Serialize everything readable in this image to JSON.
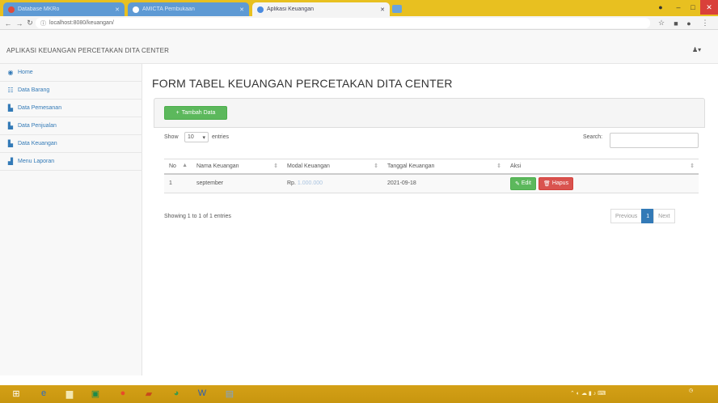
{
  "browser": {
    "tabs": [
      {
        "title": "Database MKRo",
        "active": false,
        "favicon": "db-icon"
      },
      {
        "title": "AMICTA Pembukaan",
        "active": false,
        "favicon": "chrome-icon"
      },
      {
        "title": "Aplikasi Keuangan",
        "active": true,
        "favicon": "chrome-icon"
      }
    ],
    "url": "localhost:8080/keuangan/"
  },
  "app": {
    "brand": "APLIKASI KEUANGAN PERCETAKAN DITA CENTER",
    "user_icon": "user-icon"
  },
  "sidebar": {
    "items": [
      {
        "label": "Home",
        "icon": "dashboard-icon"
      },
      {
        "label": "Data Barang",
        "icon": "table-icon"
      },
      {
        "label": "Data Pemesanan",
        "icon": "edit-icon"
      },
      {
        "label": "Data Penjualan",
        "icon": "edit-icon"
      },
      {
        "label": "Data Keuangan",
        "icon": "edit-icon"
      },
      {
        "label": "Menu Laporan",
        "icon": "chart-icon"
      }
    ]
  },
  "main": {
    "title": "FORM TABEL KEUANGAN PERCETAKAN DITA CENTER",
    "add_button": "Tambah Data",
    "show_label": "Show",
    "show_value": "10",
    "entries_label": "entries",
    "search_label": "Search:",
    "search_value": "",
    "columns": [
      "No",
      "Nama Keuangan",
      "Modal Keuangan",
      "Tanggal Keuangan",
      "Aksi"
    ],
    "rows": [
      {
        "no": "1",
        "nama": "september",
        "modal_prefix": "Rp.",
        "modal_value": "1.000.000",
        "tanggal": "2021-09-18",
        "edit": "Edit",
        "hapus": "Hapus"
      }
    ],
    "showing": "Showing 1 to 1 of 1 entries",
    "pagination": {
      "previous": "Previous",
      "page": "1",
      "next": "Next"
    }
  },
  "colors": {
    "accent": "#337ab7",
    "success": "#5cb85c",
    "danger": "#d9534f",
    "taskbar": "#d4a017"
  }
}
